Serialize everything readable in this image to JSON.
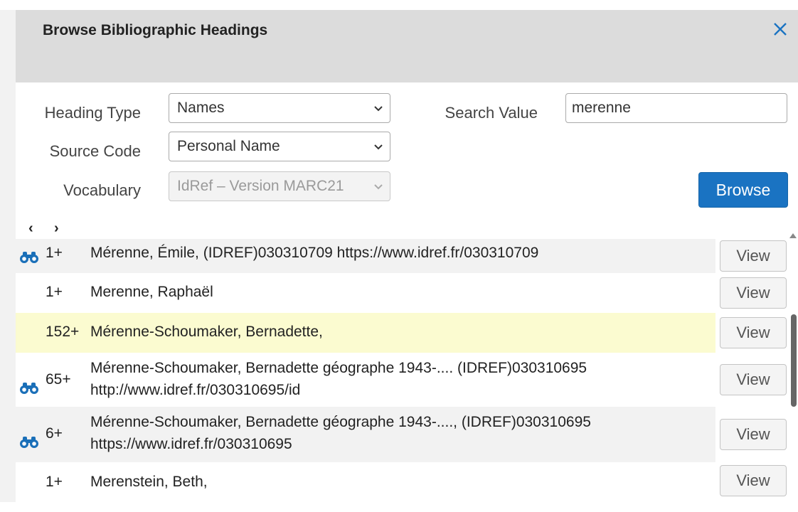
{
  "dialog": {
    "title": "Browse Bibliographic Headings",
    "close_icon": "close-icon"
  },
  "form": {
    "heading_type": {
      "label": "Heading Type",
      "value": "Names"
    },
    "search_value": {
      "label": "Search Value",
      "value": "merenne"
    },
    "source_code": {
      "label": "Source Code",
      "value": "Personal Name"
    },
    "vocabulary": {
      "label": "Vocabulary",
      "value": "IdRef – Version MARC21",
      "disabled": true
    },
    "browse_label": "Browse"
  },
  "pager": {
    "prev": "‹",
    "next": "›"
  },
  "results": [
    {
      "icon": "binoculars-icon",
      "count": "1+",
      "lines": [
        "Mérenne, Émile, (IDREF)030310709 https://www.idref.fr/030310709"
      ],
      "view": "View"
    },
    {
      "icon": "",
      "count": "1+",
      "lines": [
        "Merenne, Raphaël"
      ],
      "view": "View"
    },
    {
      "icon": "",
      "count": "152+",
      "lines": [
        "Mérenne-Schoumaker, Bernadette,"
      ],
      "view": "View"
    },
    {
      "icon": "binoculars-icon",
      "count": "65+",
      "lines": [
        "Mérenne-Schoumaker, Bernadette géographe 1943-.... (IDREF)030310695",
        "http://www.idref.fr/030310695/id"
      ],
      "view": "View"
    },
    {
      "icon": "binoculars-icon",
      "count": "6+",
      "lines": [
        "Mérenne-Schoumaker, Bernadette géographe 1943-...., (IDREF)030310695",
        "https://www.idref.fr/030310695"
      ],
      "view": "View"
    },
    {
      "icon": "",
      "count": "1+",
      "lines": [
        "Merenstein, Beth,"
      ],
      "view": "View"
    }
  ],
  "colors": {
    "accent": "#1a73c2",
    "highlight_row": "#fbfbd0",
    "icon": "#1a6fb8"
  }
}
